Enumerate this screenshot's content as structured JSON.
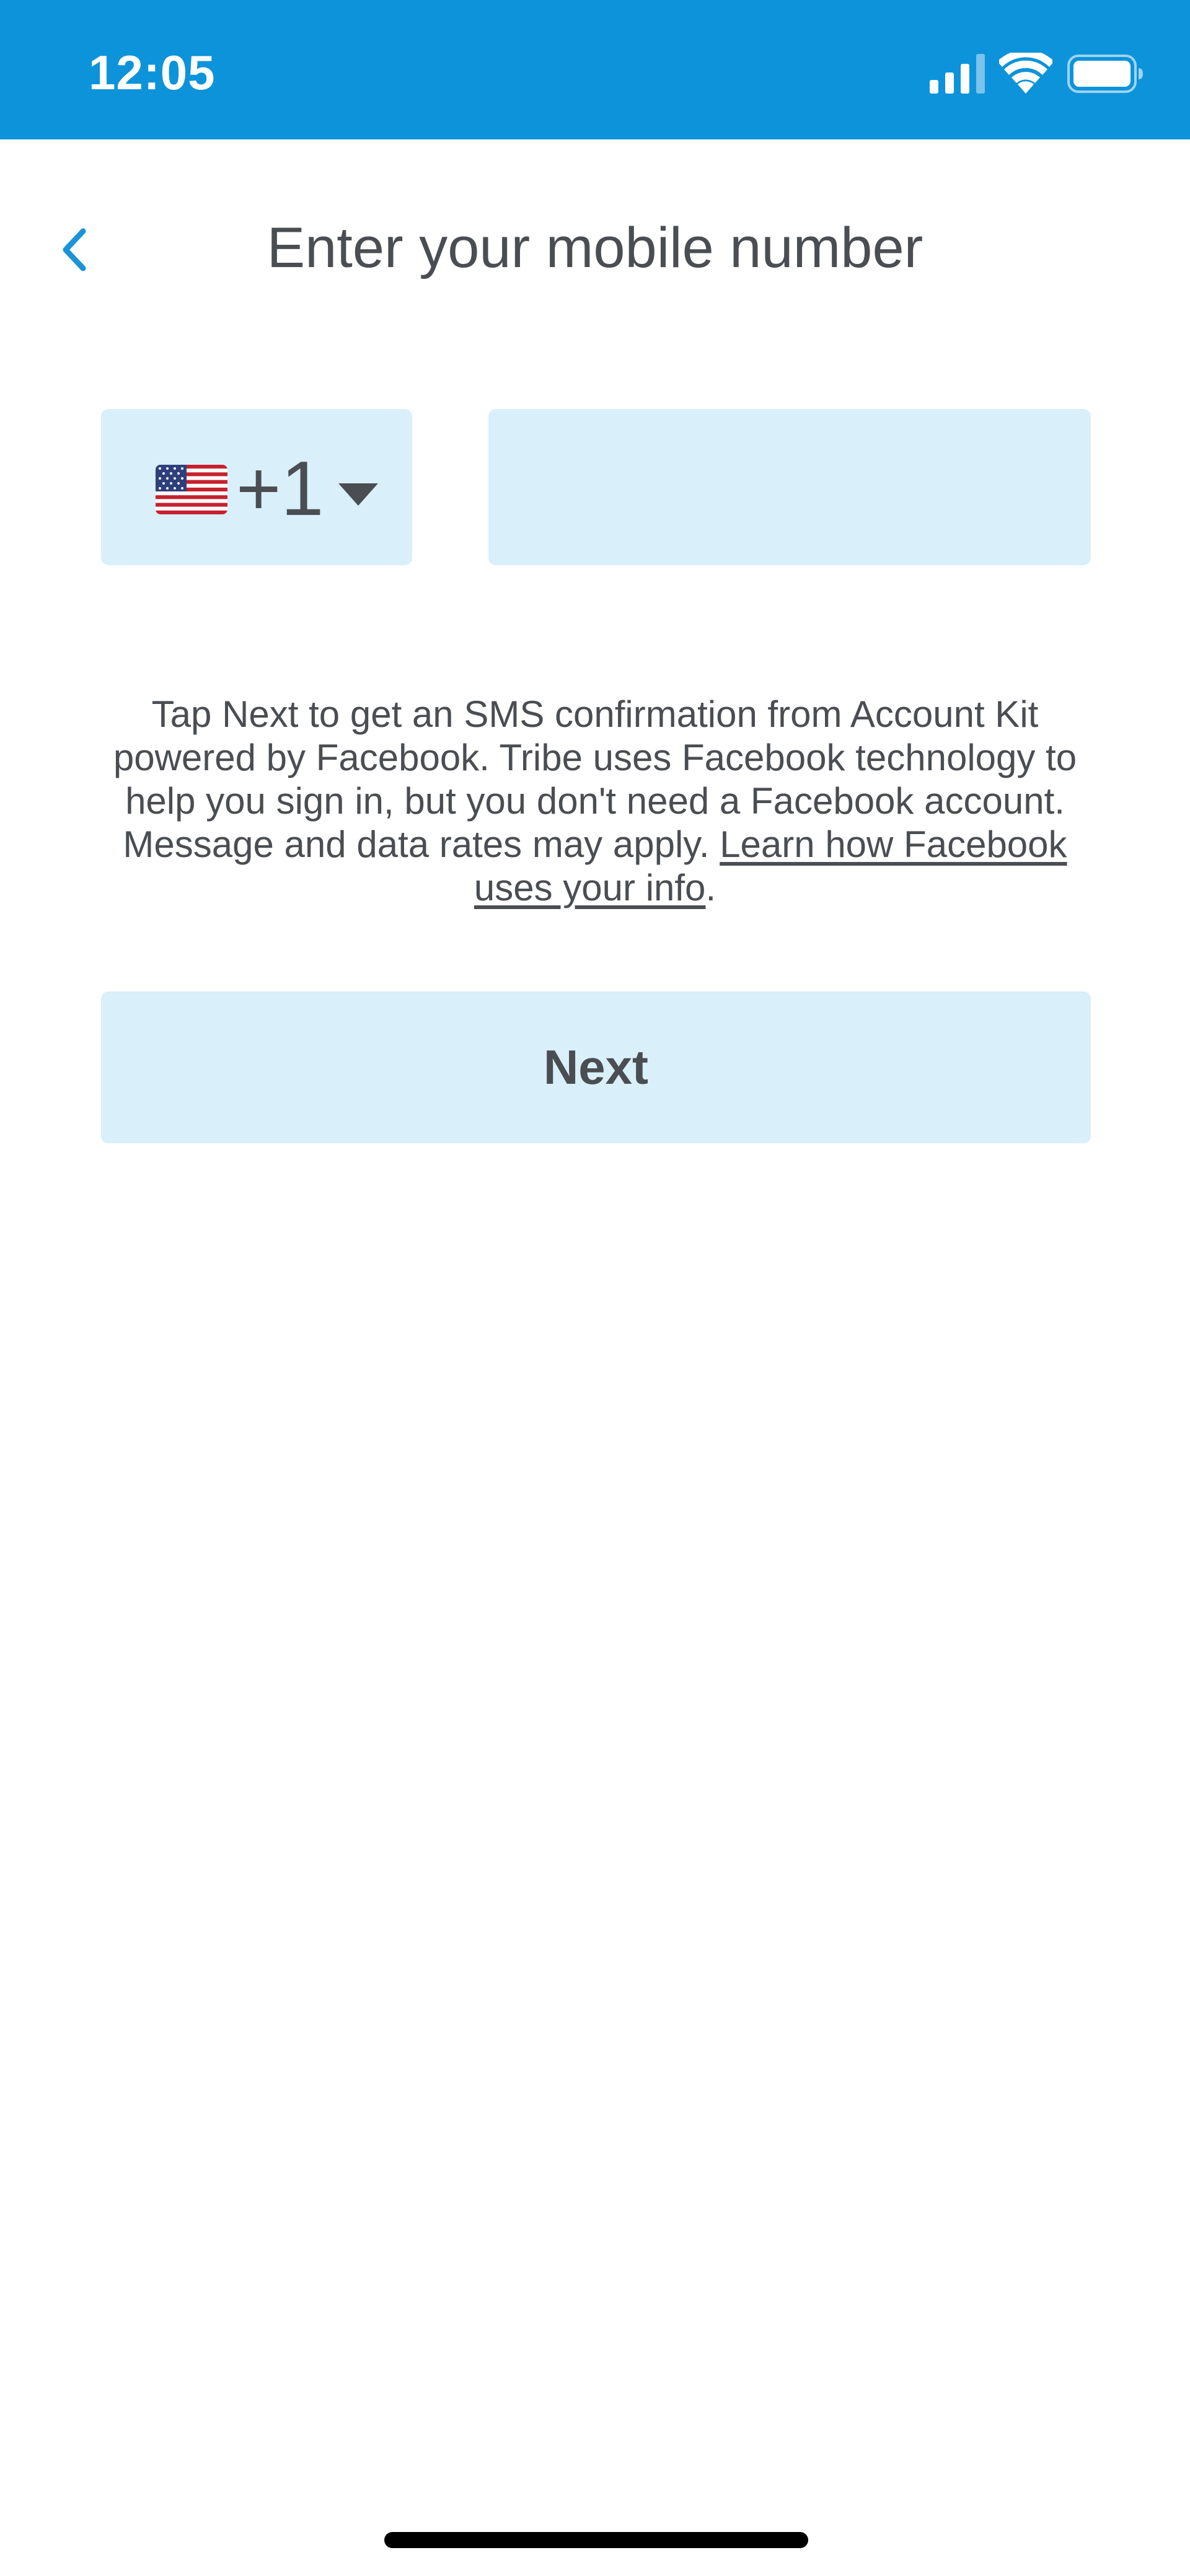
{
  "status_bar": {
    "time": "12:05",
    "background": "#0d93da",
    "icons": [
      "signal-icon",
      "wifi-icon",
      "battery-icon"
    ]
  },
  "header": {
    "back_icon": "chevron-left-icon",
    "title": "Enter your mobile number",
    "accent": "#1a93d8"
  },
  "phone_form": {
    "country_flag": "us-flag-icon",
    "country_code": "+1",
    "dropdown_icon": "caret-down-icon",
    "phone_value": "",
    "phone_placeholder": "",
    "field_background": "#d9eff9"
  },
  "disclaimer": {
    "text": "Tap Next to get an SMS confirmation from Account Kit powered by Facebook. Tribe uses Facebook technology to help you sign in, but you don't need a Facebook account. Message and data rates may apply. ",
    "link_text": "Learn how Facebook uses your info",
    "suffix": "."
  },
  "actions": {
    "next_label": "Next",
    "button_background": "#d9eff9"
  }
}
